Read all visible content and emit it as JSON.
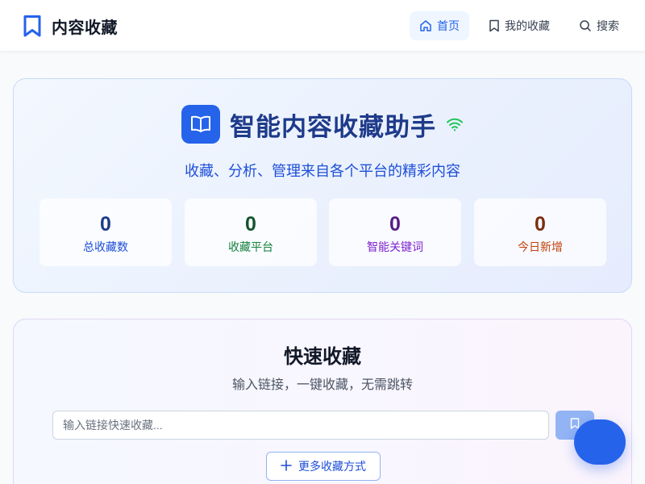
{
  "header": {
    "brand_icon": "bookmark-icon",
    "brand_title": "内容收藏",
    "nav": [
      {
        "label": "首页",
        "icon": "home-icon",
        "active": true
      },
      {
        "label": "我的收藏",
        "icon": "bookmark-icon",
        "active": false
      },
      {
        "label": "搜索",
        "icon": "search-icon",
        "active": false
      }
    ]
  },
  "hero": {
    "icon": "book-open-icon",
    "title": "智能内容收藏助手",
    "status_icon": "wifi-icon",
    "subtitle": "收藏、分析、管理来自各个平台的精彩内容",
    "stats": [
      {
        "value": "0",
        "label": "总收藏数",
        "color": "#1e3a8a",
        "label_color": "#1d4ed8"
      },
      {
        "value": "0",
        "label": "收藏平台",
        "color": "#14532d",
        "label_color": "#15803d"
      },
      {
        "value": "0",
        "label": "智能关键词",
        "color": "#581c87",
        "label_color": "#7e22ce"
      },
      {
        "value": "0",
        "label": "今日新增",
        "color": "#7c2d12",
        "label_color": "#c2410c"
      }
    ]
  },
  "quick_save": {
    "title": "快速收藏",
    "subtitle": "输入链接，一键收藏，无需跳转",
    "input_placeholder": "输入链接快速收藏...",
    "input_value": "",
    "save_icon": "bookmark-icon",
    "more_icon": "plus-icon",
    "more_label": "更多收藏方式"
  },
  "colors": {
    "accent": "#2563eb",
    "accent_light": "#eff6ff",
    "save_button_disabled": "#93b4f4"
  },
  "fab": {
    "icon": "none"
  }
}
